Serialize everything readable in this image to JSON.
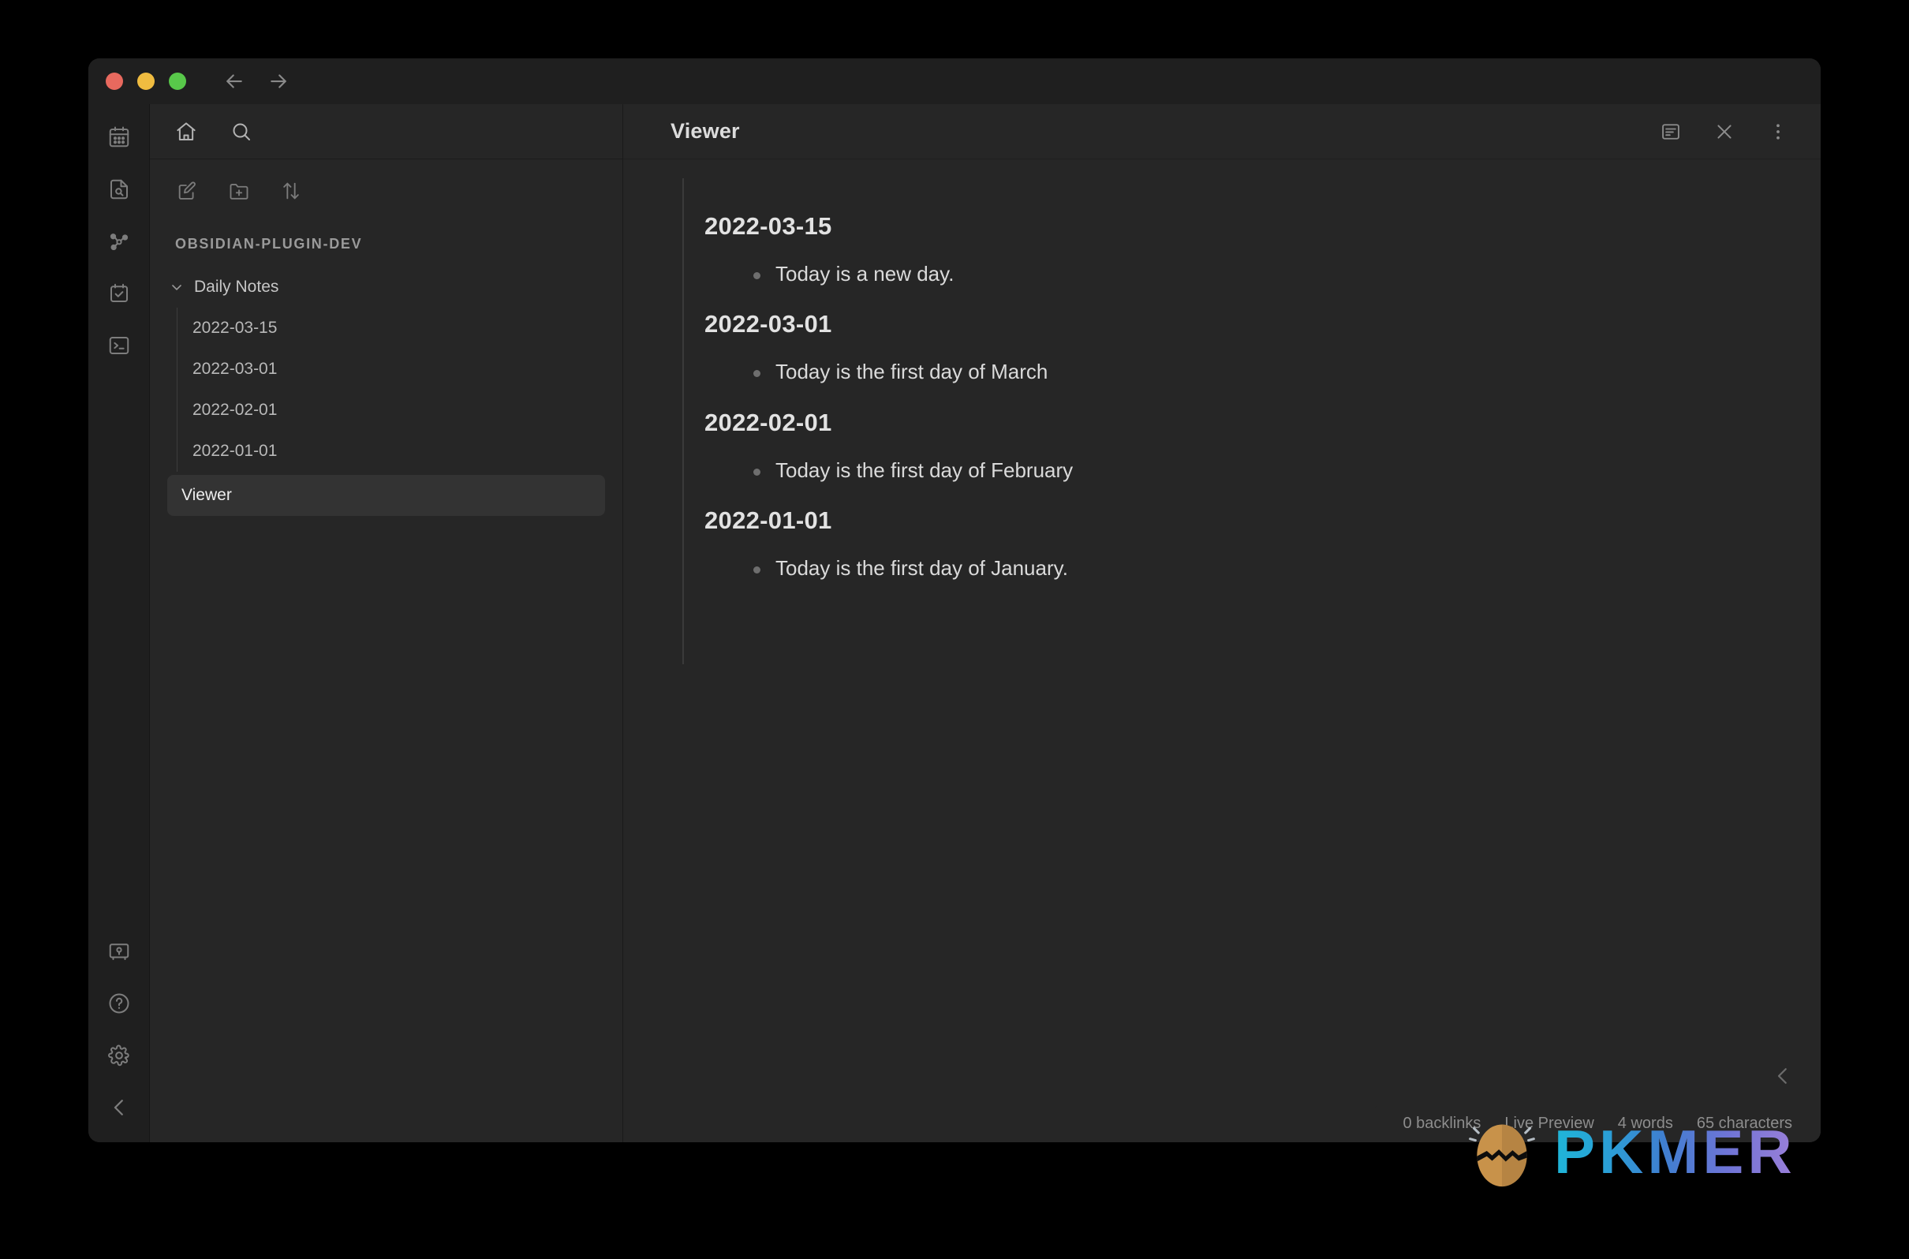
{
  "window": {
    "traffic_lights": [
      {
        "name": "close",
        "color": "#e8695e"
      },
      {
        "name": "minimize",
        "color": "#f0bc40"
      },
      {
        "name": "maximize",
        "color": "#58c84a"
      }
    ],
    "nav_back": "back-arrow",
    "nav_forward": "forward-arrow"
  },
  "ribbon": {
    "top_items": [
      {
        "name": "calendar",
        "label": "Calendar"
      },
      {
        "name": "file-search",
        "label": "Search in file"
      },
      {
        "name": "graph",
        "label": "Graph view"
      },
      {
        "name": "tasks",
        "label": "Tasks"
      },
      {
        "name": "terminal",
        "label": "Terminal"
      }
    ],
    "bottom_items": [
      {
        "name": "vault",
        "label": "Open another vault"
      },
      {
        "name": "help",
        "label": "Help"
      },
      {
        "name": "settings",
        "label": "Settings"
      },
      {
        "name": "collapse",
        "label": "Collapse sidebar"
      }
    ]
  },
  "explorer": {
    "nav_icons": [
      {
        "name": "home",
        "label": "Home"
      },
      {
        "name": "search",
        "label": "Search"
      }
    ],
    "toolbar_icons": [
      {
        "name": "new-note",
        "label": "New note"
      },
      {
        "name": "new-folder",
        "label": "New folder"
      },
      {
        "name": "sort",
        "label": "Change sort order"
      }
    ],
    "vault_name": "OBSIDIAN-PLUGIN-DEV",
    "folder": {
      "label": "Daily Notes",
      "expanded": true,
      "files": [
        "2022-03-15",
        "2022-03-01",
        "2022-02-01",
        "2022-01-01"
      ]
    },
    "root_file": {
      "label": "Viewer",
      "selected": true
    }
  },
  "view": {
    "title": "Viewer",
    "actions": [
      {
        "name": "reading-view",
        "label": "Current view"
      },
      {
        "name": "close",
        "label": "Close"
      },
      {
        "name": "more-options",
        "label": "More options"
      }
    ]
  },
  "document": {
    "entries": [
      {
        "heading": "2022-03-15",
        "bullets": [
          "Today is a new day."
        ]
      },
      {
        "heading": "2022-03-01",
        "bullets": [
          "Today is the first day of March"
        ]
      },
      {
        "heading": "2022-02-01",
        "bullets": [
          "Today is the first day of February"
        ]
      },
      {
        "heading": "2022-01-01",
        "bullets": [
          "Today is the first day of January."
        ]
      }
    ]
  },
  "right_sidebar_toggle": {
    "name": "expand-right-sidebar",
    "label": "Expand"
  },
  "statusbar": {
    "backlinks": "0 backlinks",
    "mode": "Live Preview",
    "words": "4 words",
    "characters": "65 characters"
  },
  "watermark": {
    "text": "PKMER",
    "gradient_from": "#1fb6d8",
    "gradient_to": "#9b7fd8",
    "egg_color": "#c8924a"
  }
}
